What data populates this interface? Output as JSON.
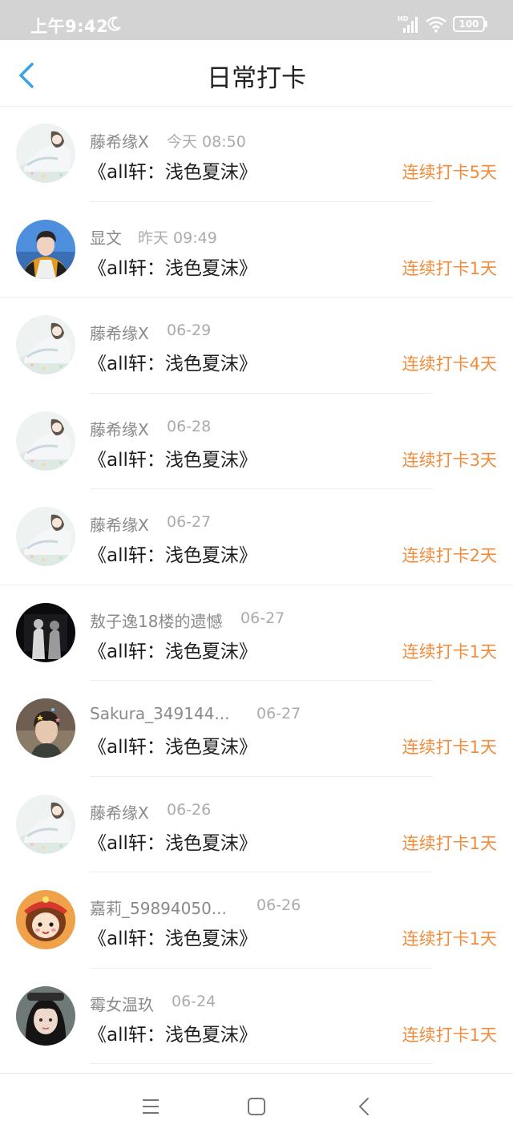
{
  "status_bar": {
    "time": "上午9:42",
    "network": "HD",
    "battery": "100",
    "icons": [
      "moon-icon",
      "hd-signal-icon",
      "wifi-icon",
      "battery-icon"
    ]
  },
  "header": {
    "title": "日常打卡",
    "back_icon": "chevron-left-icon"
  },
  "checkins": [
    {
      "user": "藤希缘X",
      "time": "今天 08:50",
      "book": "《all轩：浅色夏沫》",
      "streak": "连续打卡5天",
      "avatar": "anime-girl-light"
    },
    {
      "user": "显文",
      "time": "昨天 09:49",
      "book": "《all轩：浅色夏沫》",
      "streak": "连续打卡1天",
      "avatar": "boy-photo-blue-sky"
    },
    {
      "user": "藤希缘X",
      "time": "06-29",
      "book": "《all轩：浅色夏沫》",
      "streak": "连续打卡4天",
      "avatar": "anime-girl-light"
    },
    {
      "user": "藤希缘X",
      "time": "06-28",
      "book": "《all轩：浅色夏沫》",
      "streak": "连续打卡3天",
      "avatar": "anime-girl-light"
    },
    {
      "user": "藤希缘X",
      "time": "06-27",
      "book": "《all轩：浅色夏沫》",
      "streak": "连续打卡2天",
      "avatar": "anime-girl-light"
    },
    {
      "user": "敖子逸18楼的遗憾",
      "time": "06-27",
      "book": "《all轩：浅色夏沫》",
      "streak": "连续打卡1天",
      "avatar": "dark-photo"
    },
    {
      "user": "Sakura_349144...",
      "time": "06-27",
      "book": "《all轩：浅色夏沫》",
      "streak": "连续打卡1天",
      "avatar": "girl-with-stars"
    },
    {
      "user": "藤希缘X",
      "time": "06-26",
      "book": "《all轩：浅色夏沫》",
      "streak": "连续打卡1天",
      "avatar": "anime-girl-light"
    },
    {
      "user": "嘉莉_59894050...",
      "time": "06-26",
      "book": "《all轩：浅色夏沫》",
      "streak": "连续打卡1天",
      "avatar": "cartoon-girl-orange"
    },
    {
      "user": "霉女温玖",
      "time": "06-24",
      "book": "《all轩：浅色夏沫》",
      "streak": "连续打卡1天",
      "avatar": "girl-photo-dark-hair"
    }
  ],
  "nav": {
    "icons": [
      "menu-icon",
      "home-square-icon",
      "back-triangle-icon"
    ]
  },
  "colors": {
    "accent": "#3aa0e8",
    "streak": "#f08c3c",
    "status_bar_bg": "#d3d3d3"
  }
}
